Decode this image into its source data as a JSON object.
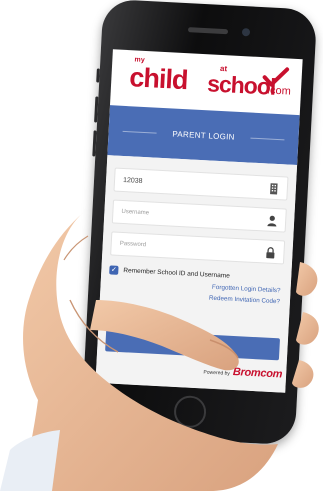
{
  "app": {
    "logo": {
      "my": "my",
      "child": "child",
      "at": "at",
      "school": "school",
      "com": ".com"
    },
    "banner_title": "PARENT LOGIN"
  },
  "form": {
    "school_id_value": "12038",
    "school_id_icon": "building-icon",
    "username_placeholder": "Username",
    "username_icon": "user-icon",
    "password_placeholder": "Password",
    "password_icon": "lock-icon",
    "remember_label": "Remember School ID and Username",
    "remember_checked": true,
    "forgotten_link": "Forgotten Login Details?",
    "invitation_link": "Redeem Invitation Code?"
  },
  "footer": {
    "powered_by": "Powered by",
    "brand": "Bromcom"
  },
  "colors": {
    "accent": "#4a6db5",
    "brand_red": "#c8102e",
    "link": "#3f65b3"
  }
}
